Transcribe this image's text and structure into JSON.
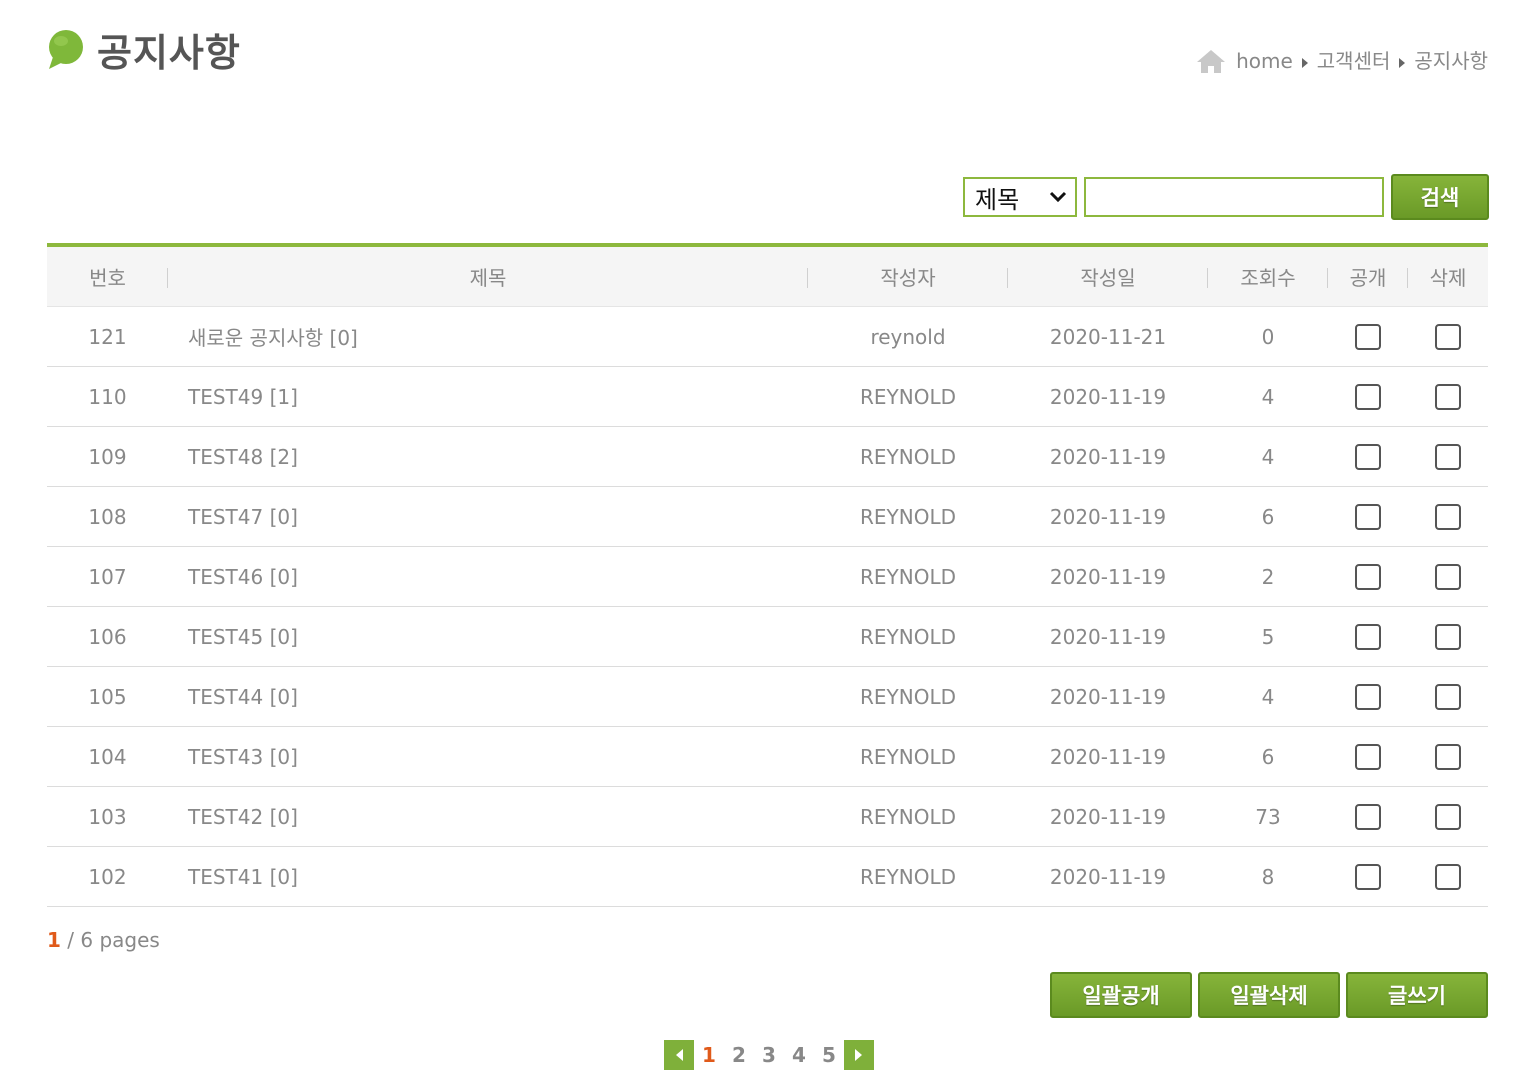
{
  "header": {
    "title": "공지사항",
    "breadcrumb": [
      "home",
      "고객센터",
      "공지사항"
    ]
  },
  "search": {
    "selected_option": "제목",
    "query": "",
    "button_label": "검색"
  },
  "table": {
    "columns": [
      "번호",
      "제목",
      "작성자",
      "작성일",
      "조회수",
      "공개",
      "삭제"
    ],
    "rows": [
      {
        "no": "121",
        "title": "새로운 공지사항 [0]",
        "author": "reynold",
        "date": "2020-11-21",
        "views": "0"
      },
      {
        "no": "110",
        "title": "TEST49 [1]",
        "author": "REYNOLD",
        "date": "2020-11-19",
        "views": "4"
      },
      {
        "no": "109",
        "title": "TEST48 [2]",
        "author": "REYNOLD",
        "date": "2020-11-19",
        "views": "4"
      },
      {
        "no": "108",
        "title": "TEST47 [0]",
        "author": "REYNOLD",
        "date": "2020-11-19",
        "views": "6"
      },
      {
        "no": "107",
        "title": "TEST46 [0]",
        "author": "REYNOLD",
        "date": "2020-11-19",
        "views": "2"
      },
      {
        "no": "106",
        "title": "TEST45 [0]",
        "author": "REYNOLD",
        "date": "2020-11-19",
        "views": "5"
      },
      {
        "no": "105",
        "title": "TEST44 [0]",
        "author": "REYNOLD",
        "date": "2020-11-19",
        "views": "4"
      },
      {
        "no": "104",
        "title": "TEST43 [0]",
        "author": "REYNOLD",
        "date": "2020-11-19",
        "views": "6"
      },
      {
        "no": "103",
        "title": "TEST42 [0]",
        "author": "REYNOLD",
        "date": "2020-11-19",
        "views": "73"
      },
      {
        "no": "102",
        "title": "TEST41 [0]",
        "author": "REYNOLD",
        "date": "2020-11-19",
        "views": "8"
      }
    ]
  },
  "page_info": {
    "current": "1",
    "rest": " / 6 pages"
  },
  "actions": {
    "publish_all": "일괄공개",
    "delete_all": "일괄삭제",
    "write": "글쓰기"
  },
  "pagination": {
    "pages": [
      "1",
      "2",
      "3",
      "4",
      "5"
    ],
    "active": "1"
  },
  "colors": {
    "accent": "#8db83d",
    "button": "#6a9a27",
    "current_page": "#e05a1a"
  },
  "icons": [
    "speech-bubble-icon",
    "home-icon",
    "breadcrumb-arrow-icon",
    "chevron-down-icon",
    "prev-arrow-icon",
    "next-arrow-icon"
  ]
}
